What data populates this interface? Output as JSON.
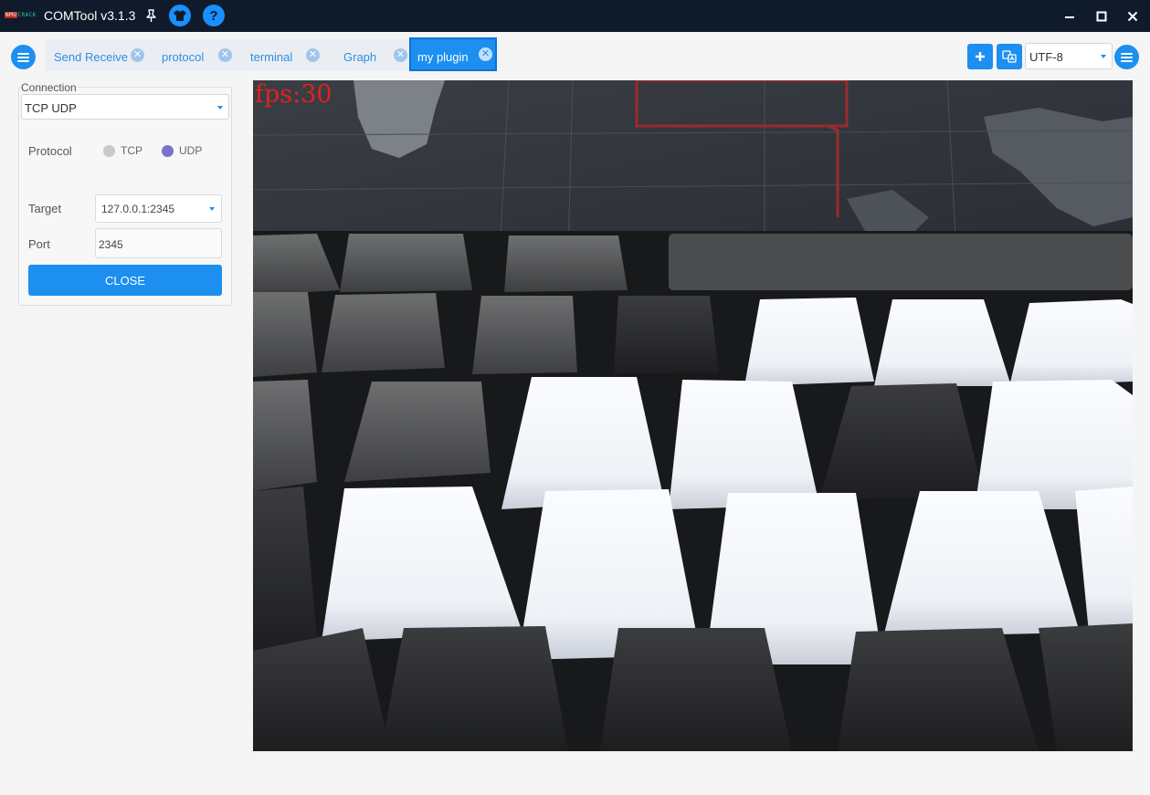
{
  "window": {
    "title": "COMTool v3.1.3",
    "logo_text_a": "NMU",
    "logo_text_b": "CRACK"
  },
  "tabs": [
    {
      "label": "Send Receive"
    },
    {
      "label": "protocol"
    },
    {
      "label": "terminal"
    },
    {
      "label": "Graph"
    },
    {
      "label": "my plugin",
      "active": true
    }
  ],
  "encoding": {
    "value": "UTF-8"
  },
  "connection": {
    "title": "Connection",
    "type_value": "TCP UDP",
    "protocol_label": "Protocol",
    "protocol_options": [
      "TCP",
      "UDP"
    ],
    "protocol_selected": "UDP",
    "target_label": "Target",
    "target_value": "127.0.0.1:2345",
    "port_label": "Port",
    "port_value": "2345",
    "close_label": "CLOSE"
  },
  "camera": {
    "fps_text": "fps:30"
  },
  "colors": {
    "accent": "#1c8ff0",
    "titlebar": "#0f1b2a",
    "fps_text": "#e3211c",
    "radio_selected": "#7b73c9",
    "radio_unselected": "#c9c9c9"
  }
}
